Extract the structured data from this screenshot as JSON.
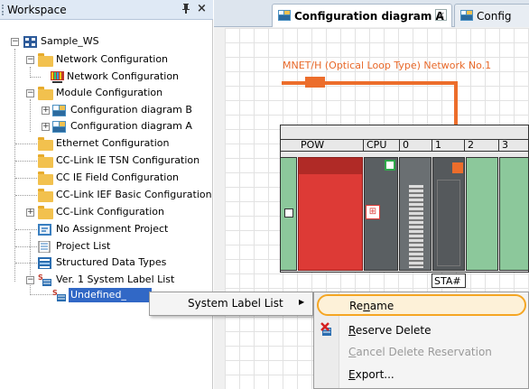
{
  "workspace": {
    "title": "Workspace",
    "pin_glyph": "ɐ",
    "close_glyph": "×",
    "root": "Sample_WS",
    "items": [
      "Network Configuration",
      "Network Configuration",
      "Module Configuration",
      "Configuration diagram B",
      "Configuration diagram A",
      "Ethernet Configuration",
      "CC-Link IE TSN Configuration",
      "CC IE Field Configuration",
      "CC-Link IEF Basic Configuration",
      "CC-Link Configuration",
      "No Assignment Project",
      "Project List",
      "Structured Data Types",
      "Ver. 1 System Label List",
      "Undefined_"
    ]
  },
  "tabs": [
    {
      "label": "Configuration diagram A",
      "close_glyph": "×",
      "active": true
    },
    {
      "label": "Config",
      "active": false
    }
  ],
  "diagram": {
    "network_label": "MNET/H (Optical Loop Type) Network No.1",
    "slots": [
      "POW",
      "CPU",
      "0",
      "1",
      "2",
      "3"
    ],
    "station_label": "STA#"
  },
  "context_menu": {
    "system_label_list": "System Label List",
    "submenu_arrow": "▶",
    "items": [
      {
        "pre": "Re",
        "key": "n",
        "post": "ame",
        "enabled": true,
        "highlighted": true
      },
      {
        "pre": "",
        "key": "R",
        "post": "eserve Delete",
        "enabled": true
      },
      {
        "pre": "",
        "key": "C",
        "post": "ancel Delete Reservation",
        "enabled": false
      },
      {
        "pre": "",
        "key": "E",
        "post": "xport...",
        "enabled": true
      }
    ]
  },
  "colors": {
    "network_line": "#ec6d2b",
    "module_green": "#8cc89b",
    "power_red": "#dd3a36",
    "highlight_border": "#f5a623"
  }
}
